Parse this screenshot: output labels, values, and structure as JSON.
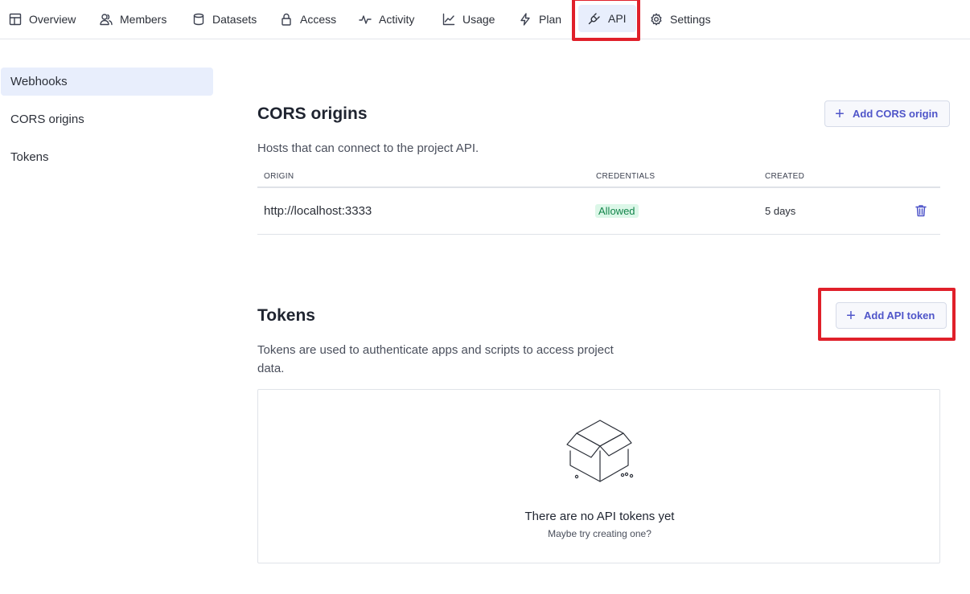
{
  "nav": {
    "tabs": [
      {
        "label": "Overview",
        "icon": "layout-icon"
      },
      {
        "label": "Members",
        "icon": "users-icon"
      },
      {
        "label": "Datasets",
        "icon": "database-icon"
      },
      {
        "label": "Access",
        "icon": "lock-icon"
      },
      {
        "label": "Activity",
        "icon": "pulse-icon"
      },
      {
        "label": "Usage",
        "icon": "chart-icon"
      },
      {
        "label": "Plan",
        "icon": "bolt-icon"
      },
      {
        "label": "API",
        "icon": "plug-icon"
      },
      {
        "label": "Settings",
        "icon": "gear-icon"
      }
    ],
    "active": "API"
  },
  "sidebar": {
    "items": [
      {
        "label": "Webhooks"
      },
      {
        "label": "CORS origins"
      },
      {
        "label": "Tokens"
      }
    ],
    "active": "Webhooks"
  },
  "cors": {
    "title": "CORS origins",
    "description": "Hosts that can connect to the project API.",
    "add_label": "Add CORS origin",
    "columns": {
      "origin": "ORIGIN",
      "credentials": "CREDENTIALS",
      "created": "CREATED"
    },
    "rows": [
      {
        "origin": "http://localhost:3333",
        "credentials": "Allowed",
        "created": "5 days"
      }
    ]
  },
  "tokens": {
    "title": "Tokens",
    "description_line1": "Tokens are used to authenticate apps and scripts to access project",
    "description_line2": "data.",
    "add_label": "Add API token",
    "empty_title": "There are no API tokens yet",
    "empty_subtitle": "Maybe try creating one?"
  },
  "colors": {
    "accent": "#4f55c9",
    "active_bg": "#e8eefc",
    "highlight": "#e0202a",
    "badge_bg": "#dcf7e8",
    "badge_text": "#12844a"
  }
}
